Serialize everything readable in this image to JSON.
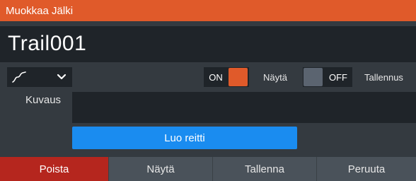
{
  "dialog": {
    "title": "Muokkaa Jälki",
    "trail_name": "Trail001"
  },
  "controls": {
    "line_style_icon": "line-style-icon",
    "dropdown_icon": "chevron-down-icon",
    "show_toggle_state": "ON",
    "show_label": "Näytä",
    "record_toggle_state": "OFF",
    "record_label": "Tallennus"
  },
  "description": {
    "label": "Kuvaus",
    "value": ""
  },
  "create_route_label": "Luo reitti",
  "bottom_buttons": {
    "delete": "Poista",
    "show": "Näytä",
    "save": "Tallenna",
    "cancel": "Peruuta"
  },
  "colors": {
    "accent": "#e05a2a",
    "primary_button": "#1a8cf0",
    "delete_button": "#b5261e",
    "toggle_off": "#5b6470"
  }
}
